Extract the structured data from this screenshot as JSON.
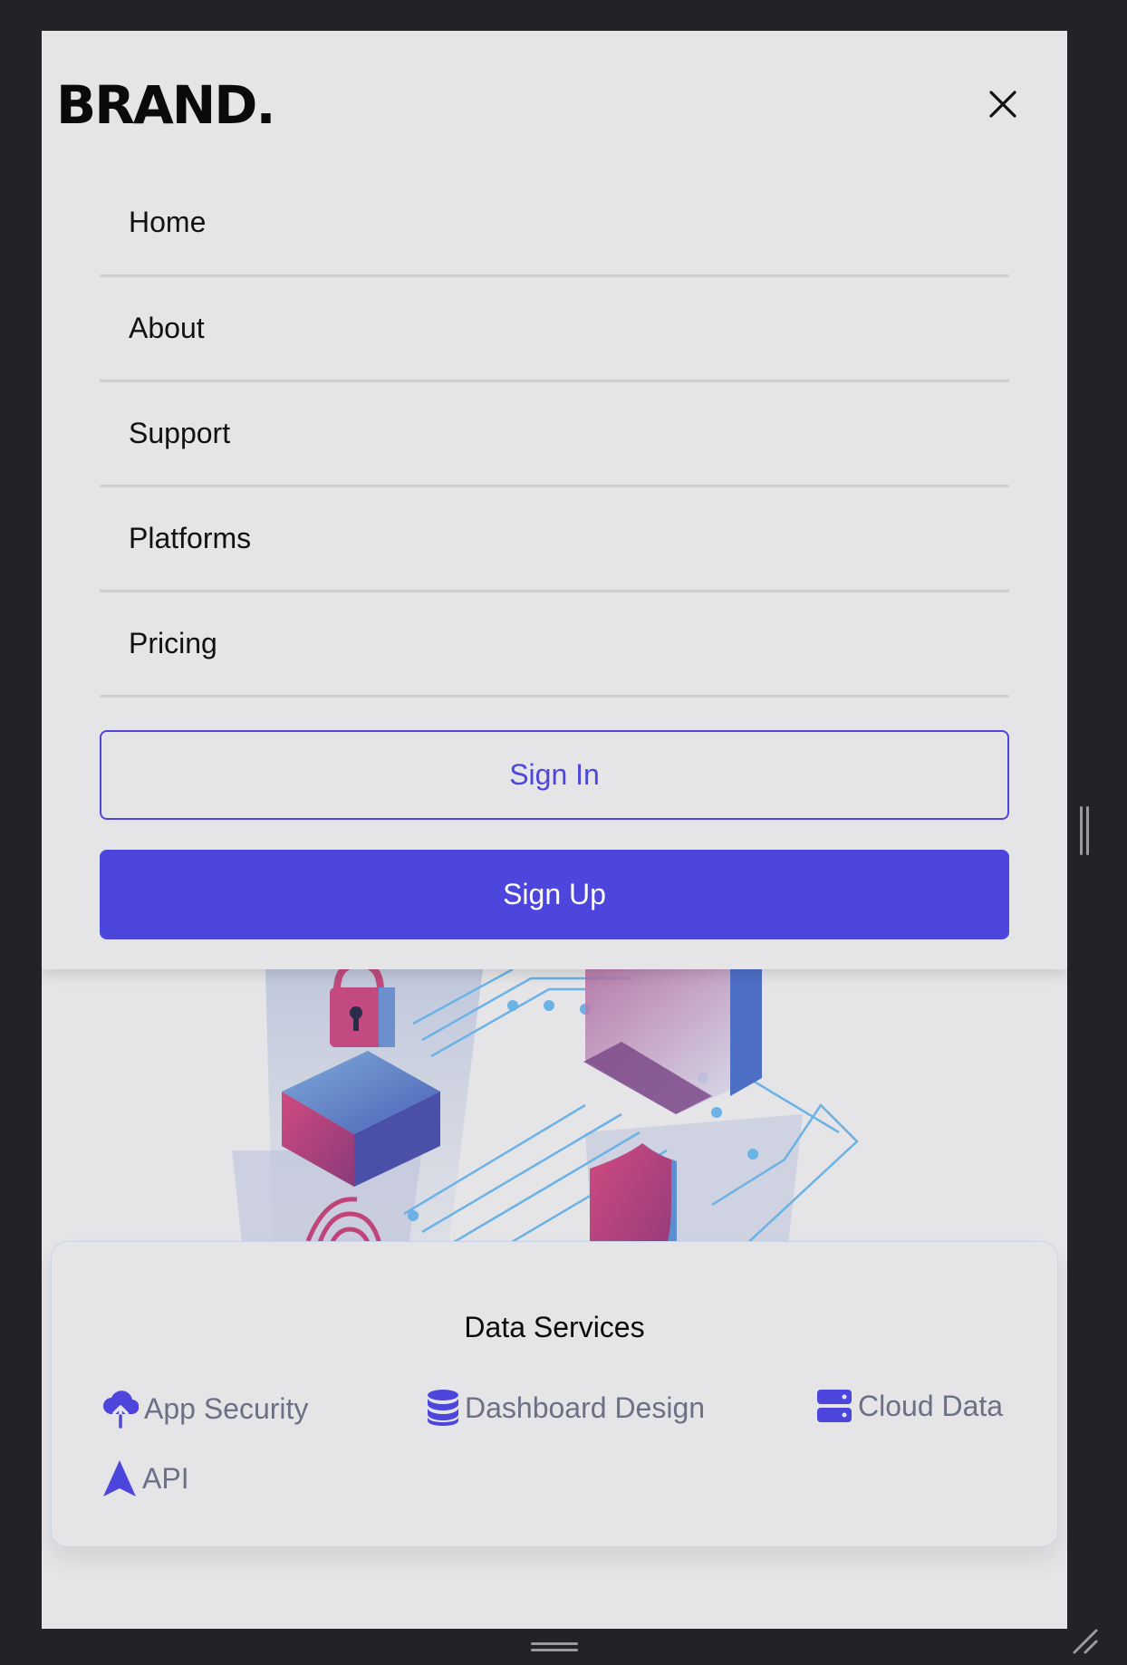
{
  "header": {
    "brand": "BRAND.",
    "close_icon": "close-icon"
  },
  "nav": {
    "items": [
      {
        "label": "Home"
      },
      {
        "label": "About"
      },
      {
        "label": "Support"
      },
      {
        "label": "Platforms"
      },
      {
        "label": "Pricing"
      }
    ]
  },
  "auth": {
    "sign_in": "Sign In",
    "sign_up": "Sign Up"
  },
  "services": {
    "title": "Data Services",
    "items": [
      {
        "label": "App Security",
        "icon": "cloud-upload-icon"
      },
      {
        "label": "Dashboard Design",
        "icon": "database-icon"
      },
      {
        "label": "Cloud Data",
        "icon": "server-icon"
      },
      {
        "label": "API",
        "icon": "navigation-arrow-icon"
      }
    ]
  },
  "colors": {
    "accent": "#4c46dc",
    "background": "#e5e5e8",
    "frame": "#222326",
    "muted_text": "#6b7085"
  }
}
